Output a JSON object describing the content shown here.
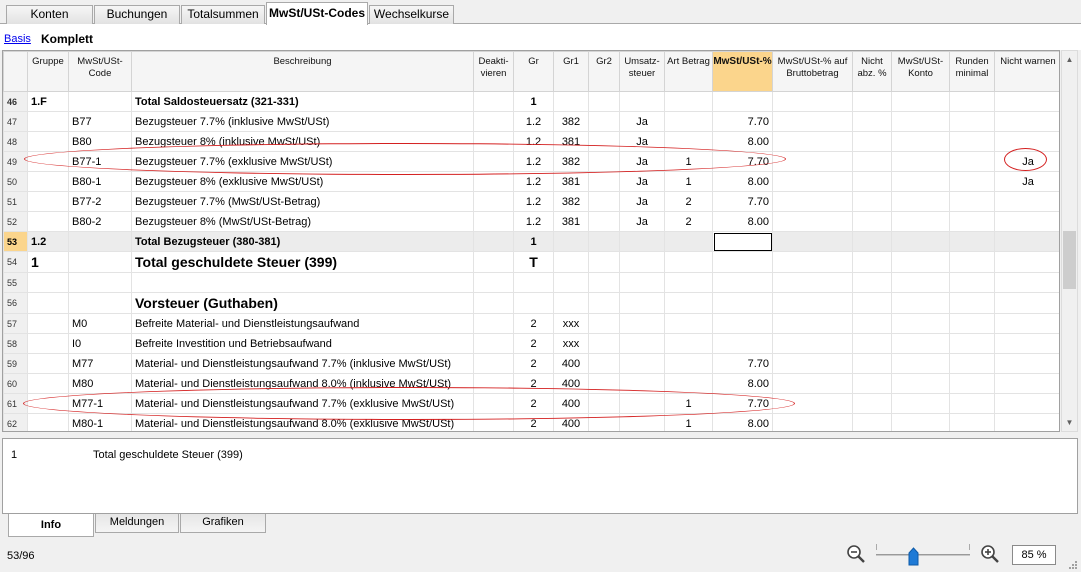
{
  "tabs": [
    "Konten",
    "Buchungen",
    "Totalsummen",
    "MwSt/USt-Codes",
    "Wechselkurse"
  ],
  "active_tab": "MwSt/USt-Codes",
  "views": {
    "basis": "Basis",
    "komplett": "Komplett"
  },
  "columns": [
    {
      "key": "gruppe",
      "label": "Gruppe"
    },
    {
      "key": "code",
      "label": "MwSt/USt-Code"
    },
    {
      "key": "beschreibung",
      "label": "Beschreibung"
    },
    {
      "key": "deaktivieren",
      "label": "Deakti-vieren"
    },
    {
      "key": "gr",
      "label": "Gr"
    },
    {
      "key": "gr1",
      "label": "Gr1"
    },
    {
      "key": "gr2",
      "label": "Gr2"
    },
    {
      "key": "umsatzsteuer",
      "label": "Umsatz-steuer"
    },
    {
      "key": "art_betrag",
      "label": "Art Betrag"
    },
    {
      "key": "mwst_prozent",
      "label": "MwSt/USt-%"
    },
    {
      "key": "brutto",
      "label": "MwSt/USt-% auf Bruttobetrag"
    },
    {
      "key": "nicht_abz",
      "label": "Nicht abz. %"
    },
    {
      "key": "konto",
      "label": "MwSt/USt-Konto"
    },
    {
      "key": "runden",
      "label": "Runden minimal"
    },
    {
      "key": "nicht_warnen",
      "label": "Nicht warnen"
    }
  ],
  "rows": [
    {
      "n": "46",
      "gruppe": "1.F",
      "code": "",
      "beschreibung": "Total Saldosteuersatz (321-331)",
      "gr": "1",
      "gr1": "",
      "umsatz": "",
      "art": "",
      "pct": "",
      "warn": "",
      "style": "bold"
    },
    {
      "n": "47",
      "gruppe": "",
      "code": "B77",
      "beschreibung": "Bezugsteuer 7.7%  (inklusive MwSt/USt)",
      "gr": "1.2",
      "gr1": "382",
      "umsatz": "Ja",
      "art": "",
      "pct": "7.70",
      "warn": ""
    },
    {
      "n": "48",
      "gruppe": "",
      "code": "B80",
      "beschreibung": "Bezugsteuer 8%  (inklusive MwSt/USt)",
      "gr": "1.2",
      "gr1": "381",
      "umsatz": "Ja",
      "art": "",
      "pct": "8.00",
      "warn": ""
    },
    {
      "n": "49",
      "gruppe": "",
      "code": "B77-1",
      "beschreibung": "Bezugsteuer 7.7%  (exklusive MwSt/USt)",
      "gr": "1.2",
      "gr1": "382",
      "umsatz": "Ja",
      "art": "1",
      "pct": "7.70",
      "warn": "Ja"
    },
    {
      "n": "50",
      "gruppe": "",
      "code": "B80-1",
      "beschreibung": "Bezugsteuer 8%  (exklusive MwSt/USt)",
      "gr": "1.2",
      "gr1": "381",
      "umsatz": "Ja",
      "art": "1",
      "pct": "8.00",
      "warn": "Ja"
    },
    {
      "n": "51",
      "gruppe": "",
      "code": "B77-2",
      "beschreibung": "Bezugsteuer 7.7%  (MwSt/USt-Betrag)",
      "gr": "1.2",
      "gr1": "382",
      "umsatz": "Ja",
      "art": "2",
      "pct": "7.70",
      "warn": ""
    },
    {
      "n": "52",
      "gruppe": "",
      "code": "B80-2",
      "beschreibung": "Bezugsteuer 8%  (MwSt/USt-Betrag)",
      "gr": "1.2",
      "gr1": "381",
      "umsatz": "Ja",
      "art": "2",
      "pct": "8.00",
      "warn": ""
    },
    {
      "n": "53",
      "gruppe": "1.2",
      "code": "",
      "beschreibung": "Total Bezugsteuer (380-381)",
      "gr": "1",
      "gr1": "",
      "umsatz": "",
      "art": "",
      "pct": "",
      "warn": "",
      "style": "bold-selected"
    },
    {
      "n": "54",
      "gruppe": "1",
      "code": "",
      "beschreibung": "Total geschuldete Steuer (399)",
      "gr": "T",
      "gr1": "",
      "umsatz": "",
      "art": "",
      "pct": "",
      "warn": "",
      "style": "big"
    },
    {
      "n": "55",
      "gruppe": "",
      "code": "",
      "beschreibung": "",
      "gr": "",
      "gr1": "",
      "umsatz": "",
      "art": "",
      "pct": "",
      "warn": ""
    },
    {
      "n": "56",
      "gruppe": "",
      "code": "",
      "beschreibung": "Vorsteuer (Guthaben)",
      "gr": "",
      "gr1": "",
      "umsatz": "",
      "art": "",
      "pct": "",
      "warn": "",
      "style": "big"
    },
    {
      "n": "57",
      "gruppe": "",
      "code": "M0",
      "beschreibung": "Befreite Material- und Dienstleistungsaufwand",
      "gr": "2",
      "gr1": "xxx",
      "umsatz": "",
      "art": "",
      "pct": "",
      "warn": ""
    },
    {
      "n": "58",
      "gruppe": "",
      "code": "I0",
      "beschreibung": "Befreite Investition und Betriebsaufwand",
      "gr": "2",
      "gr1": "xxx",
      "umsatz": "",
      "art": "",
      "pct": "",
      "warn": ""
    },
    {
      "n": "59",
      "gruppe": "",
      "code": "M77",
      "beschreibung": "Material- und Dienstleistungsaufwand 7.7%  (inklusive MwSt/USt)",
      "gr": "2",
      "gr1": "400",
      "umsatz": "",
      "art": "",
      "pct": "7.70",
      "warn": ""
    },
    {
      "n": "60",
      "gruppe": "",
      "code": "M80",
      "beschreibung": "Material- und Dienstleistungsaufwand 8.0%  (inklusive MwSt/USt)",
      "gr": "2",
      "gr1": "400",
      "umsatz": "",
      "art": "",
      "pct": "8.00",
      "warn": ""
    },
    {
      "n": "61",
      "gruppe": "",
      "code": "M77-1",
      "beschreibung": "Material- und Dienstleistungsaufwand 7.7%  (exklusive MwSt/USt)",
      "gr": "2",
      "gr1": "400",
      "umsatz": "",
      "art": "1",
      "pct": "7.70",
      "warn": ""
    },
    {
      "n": "62",
      "gruppe": "",
      "code": "M80-1",
      "beschreibung": "Material- und Dienstleistungsaufwand 8.0%  (exklusive MwSt/USt)",
      "gr": "2",
      "gr1": "400",
      "umsatz": "",
      "art": "1",
      "pct": "8.00",
      "warn": ""
    }
  ],
  "info": {
    "num": "1",
    "text": "Total geschuldete Steuer (399)"
  },
  "bottom_tabs": [
    "Info",
    "Meldungen",
    "Grafiken"
  ],
  "status": {
    "position": "53/96",
    "zoom": "85 %"
  },
  "colors": {
    "header_highlight": "#fbd58c",
    "annotation": "#d42020"
  }
}
